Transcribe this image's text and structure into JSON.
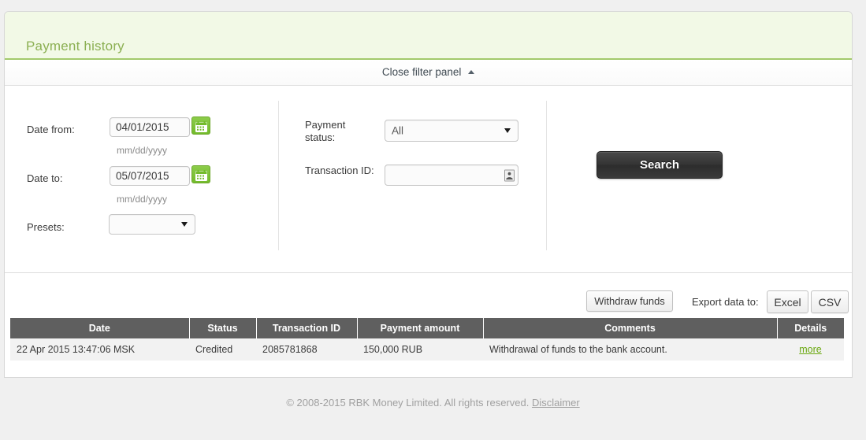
{
  "header": {
    "title": "Payment history"
  },
  "filter_toggle": {
    "label": "Close filter panel",
    "caret_icon": "caret-up-icon"
  },
  "filters": {
    "date_from": {
      "label": "Date from:",
      "value": "04/01/2015",
      "hint": "mm/dd/yyyy",
      "calendar_icon": "calendar-icon"
    },
    "date_to": {
      "label": "Date to:",
      "value": "05/07/2015",
      "hint": "mm/dd/yyyy",
      "calendar_icon": "calendar-icon"
    },
    "presets": {
      "label": "Presets:",
      "value": "",
      "options": []
    },
    "payment_status": {
      "label": "Payment status:",
      "value": "All",
      "options": [
        "All"
      ]
    },
    "transaction_id": {
      "label": "Transaction ID:",
      "value": "",
      "placeholder": "",
      "picker_icon": "contact-card-icon"
    },
    "search_button": "Search"
  },
  "actions": {
    "withdraw_funds": "Withdraw funds",
    "export_label": "Export data to:",
    "export_excel": "Excel",
    "export_csv": "CSV"
  },
  "table": {
    "columns": [
      "Date",
      "Status",
      "Transaction ID",
      "Payment amount",
      "Comments",
      "Details"
    ],
    "rows": [
      {
        "date": "22 Apr 2015 13:47:06 MSK",
        "status": "Credited",
        "transaction_id": "2085781868",
        "amount": "150,000 RUB",
        "comments": "Withdrawal of funds to the bank account.",
        "details": "more"
      }
    ]
  },
  "footer": {
    "copyright": "© 2008-2015 RBK Money Limited. All rights reserved.",
    "disclaimer": "Disclaimer"
  },
  "colors": {
    "header_bg": "#f2f9e6",
    "header_border": "#a3c96b",
    "title_text": "#8cb053",
    "calendar_green": "#7cc03a",
    "table_header_bg": "#5f5f5f",
    "link_green": "#6aa80f",
    "search_dark": "#333333"
  }
}
